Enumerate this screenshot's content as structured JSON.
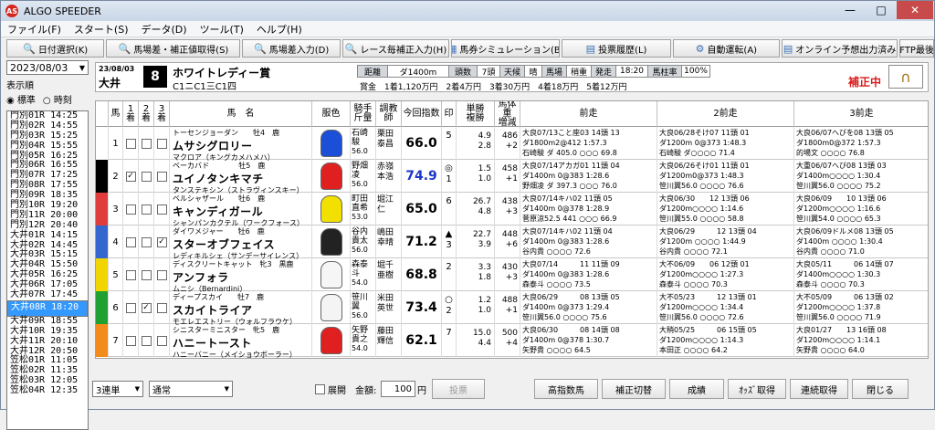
{
  "window": {
    "title": "ALGO SPEEDER",
    "app_icon": "AS",
    "minimize": "—",
    "maximize": "□",
    "close": "✕"
  },
  "menus": [
    "ファイル(F)",
    "スタート(S)",
    "データ(D)",
    "ツール(T)",
    "ヘルプ(H)"
  ],
  "toolbar": [
    {
      "icon": "search-icon",
      "label": "日付選択(K)"
    },
    {
      "icon": "search-icon",
      "label": "馬場差・補正値取得(S)"
    },
    {
      "icon": "search-icon",
      "label": "馬場差入力(D)"
    },
    {
      "icon": "search-icon",
      "label": "レース毎補正入力(H)"
    },
    {
      "icon": "grid-icon",
      "label": "馬券シミュレーション(B)"
    },
    {
      "icon": "document-icon",
      "label": "投票履歴(L)"
    },
    {
      "icon": "gear-icon",
      "label": "自動運転(A)"
    },
    {
      "icon": "document-icon",
      "label": "オンライン予想出力済み"
    },
    {
      "icon": "",
      "label": "FTP最後"
    }
  ],
  "left": {
    "date": "2023/08/03",
    "display_order_label": "表示順",
    "opt_standard": "標準",
    "opt_time": "時刻",
    "races": [
      "門別01R 14:25",
      "門別02R 14:55",
      "門別03R 15:25",
      "門別04R 15:55",
      "門別05R 16:25",
      "門別06R 16:55",
      "門別07R 17:25",
      "門別08R 17:55",
      "門別09R 18:35",
      "門別10R 19:20",
      "門別11R 20:00",
      "門別12R 20:40",
      "大井01R 14:15",
      "大井02R 14:45",
      "大井03R 15:15",
      "大井04R 15:50",
      "大井05R 16:25",
      "大井06R 17:05",
      "大井07R 17:45",
      "大井08R 18:20",
      "大井09R 18:55",
      "大井10R 19:35",
      "大井11R 20:10",
      "大井12R 20:50",
      "笠松01R 11:05",
      "笠松02R 11:35",
      "笠松03R 12:05",
      "笠松04R 12:35"
    ],
    "selected_index": 19
  },
  "race_header": {
    "date": "23/08/03",
    "venue": "大井",
    "race_number": "8",
    "name": "ホワイトレディー賞",
    "class": "C1ニC1三C1四",
    "distance_label": "距離",
    "distance": "ダ1400m",
    "runners_label": "頭数",
    "runners": "7頭",
    "weather_label": "天候",
    "weather": "晴",
    "track_label": "馬場",
    "track": "稍重",
    "post_label": "発走",
    "post_time": "18:20",
    "rate_label": "馬柱率",
    "rate": "100%",
    "prize": "賞金　1着1,120万円　2着4万円　3着30万円　4着18万円　5着12万円",
    "status": "補正中"
  },
  "columns": {
    "waku": "",
    "num": "馬",
    "c1": "1着",
    "c2": "2着",
    "c3": "3着",
    "name": "馬　名",
    "silk": "服色",
    "jockey": "騎手\n斤量",
    "trainer": "調教\n師",
    "index": "今回指数",
    "mark": "印",
    "odds": "単勝\n複勝",
    "weight": "馬体重\n増減",
    "p1": "前走",
    "p2": "2前走",
    "p3": "3前走"
  },
  "horses": [
    {
      "waku": "1",
      "waku_color": "#ffffff",
      "num": "1",
      "c1": false,
      "c2": false,
      "c3": false,
      "info": "トーセンジョーダン　　牡4　鹿",
      "name": "ムサシグロリー",
      "sire": "マクロア（キングカメハメハ）",
      "silk_color": "#1c4fd8",
      "jockey": "石崎\n駿",
      "weight": "56.0",
      "trainer": "栗田\n泰昌",
      "index": "66.0",
      "index_color": "#000000",
      "mark": "",
      "rank": "5",
      "odds": "4.9\n2.8",
      "body": "486\n+2",
      "p1a": "大良07/13こと座03 14頭 13",
      "p1b": "ダ1800m2@412 1:57.3",
      "p1c": "石崎駿 ダ 405.0 ○○○ 69.8",
      "p2a": "大良06/28そけ07 11頭 01",
      "p2b": "ダ1200m 0@373 1:48.3",
      "p2c": "石崎駿 ダ○○○○ 71.4",
      "p3a": "大良06/07へびを08 13頭 05",
      "p3b": "ダ1800m0@372 1:57.3",
      "p3c": "的場文 ○○○○ 76.8"
    },
    {
      "waku": "2",
      "waku_color": "#000000",
      "num": "2",
      "c1": true,
      "c2": false,
      "c3": false,
      "info": "ベーカバド　　　　牡5　鹿",
      "name": "ユイノタンキマチ",
      "sire": "タンステキシン（ストラヴィンスキー）",
      "silk_color": "#e02020",
      "jockey": "野畑\n凌",
      "weight": "56.0",
      "trainer": "赤嶺\n本浩",
      "index": "74.9",
      "index_color": "#1a37c8",
      "mark": "◎",
      "rank": "1",
      "odds": "1.5\n1.0",
      "body": "458\n+1",
      "p1a": "大良07/14アカガ01 11頭 04",
      "p1b": "ダ1400m 0@383 1:28.6",
      "p1c": "野畑凌 ダ 397.3 ○○○ 76.0",
      "p2a": "大良06/26そけ01 11頭 01",
      "p2b": "ダ1200m0@373 1:48.3",
      "p2c": "笹川翼56.0 ○○○○ 76.6",
      "p3a": "大重06/07へび08 13頭 03",
      "p3b": "ダ1400m○○○○ 1:30.4",
      "p3c": "笹川翼56.0 ○○○○ 75.2"
    },
    {
      "waku": "3",
      "waku_color": "#e03c3c",
      "num": "3",
      "c1": false,
      "c2": false,
      "c3": false,
      "info": "ベルシャザール　　牡6　鹿",
      "name": "キャンディガール",
      "sire": "シャンパンカクテル（ワークフォース）",
      "silk_color": "#f1e000",
      "jockey": "町田\n直希",
      "weight": "53.0",
      "trainer": "堀江\n仁",
      "index": "65.0",
      "index_color": "#000000",
      "mark": "",
      "rank": "6",
      "odds": "26.7\n4.8",
      "body": "438\n+3",
      "p1a": "大良07/14キハ02 11頭 05",
      "p1b": "ダ1400m 0@378 1:28.9",
      "p1c": "菅原涼52.5 441 ○○○ 66.9",
      "p2a": "大良06/30　　12 13頭 06",
      "p2b": "ダ1200m○○○○ 1:14.6",
      "p2c": "笹川翼55.0 ○○○○ 58.8",
      "p3a": "大良06/09　　10 13頭 06",
      "p3b": "ダ1200m○○○○ 1:16.6",
      "p3c": "笹川翼54.0 ○○○○ 65.3"
    },
    {
      "waku": "4",
      "waku_color": "#3466d0",
      "num": "4",
      "c1": false,
      "c2": false,
      "c3": true,
      "info": "ダイワメジャー　　牡6　鹿",
      "name": "スターオブフェイス",
      "sire": "レディキルシェ（サンデーサイレンス）",
      "silk_color": "#222222",
      "jockey": "谷内\n貴太",
      "weight": "56.0",
      "trainer": "嶋田\n幸晴",
      "index": "71.2",
      "index_color": "#000000",
      "mark": "▲",
      "rank": "3",
      "odds": "22.7\n3.9",
      "body": "448\n+6",
      "p1a": "大良07/14キハ02 11頭 04",
      "p1b": "ダ1400m 0@383 1:28.6",
      "p1c": "谷内貴 ○○○○ 72.6",
      "p2a": "大良06/29　　　12 13頭 04",
      "p2b": "ダ1200m ○○○○ 1:44.9",
      "p2c": "谷内貴 ○○○○ 72.1",
      "p3a": "大良06/09ドルメ08 13頭 05",
      "p3b": "ダ1400m ○○○○ 1:30.4",
      "p3c": "谷内貴 ○○○○ 71.0"
    },
    {
      "waku": "5",
      "waku_color": "#f2d500",
      "num": "5",
      "c1": false,
      "c2": false,
      "c3": false,
      "info": "ディスクリートキャット　牝3　黒鹿",
      "name": "アンフォラ",
      "sire": "ムニシ（Bernardini）",
      "silk_color": "#f6f6f6",
      "jockey": "森泰\n斗",
      "weight": "54.0",
      "trainer": "堀千\n亜樹",
      "index": "68.8",
      "index_color": "#000000",
      "mark": "",
      "rank": "2",
      "odds": "3.3\n1.8",
      "body": "430\n+3",
      "p1a": "大良07/14　　　11 11頭 09",
      "p1b": "ダ1400m 0@383 1:28.6",
      "p1c": "森泰斗 ○○○○ 73.5",
      "p2a": "大不06/09　　06 12頭 01",
      "p2b": "ダ1200m○○○○ 1:27.3",
      "p2c": "森泰斗 ○○○○ 70.3",
      "p3a": "大良05/11　　　06 14頭 07",
      "p3b": "ダ1400m○○○○ 1:30.3",
      "p3c": "森泰斗 ○○○○ 70.3"
    },
    {
      "waku": "6",
      "waku_color": "#20a030",
      "num": "6",
      "c1": false,
      "c2": true,
      "c3": false,
      "info": "ディープスカイ　　牡7　鹿",
      "name": "スカイトライア",
      "sire": "モエレエストリー（ウォルフラウケ）",
      "silk_color": "#f4f4f4",
      "jockey": "笹川\n翼",
      "weight": "56.0",
      "trainer": "米田\n英世",
      "index": "73.4",
      "index_color": "#000000",
      "mark": "○",
      "rank": "2",
      "odds": "1.2\n1.0",
      "body": "488\n+1",
      "p1a": "大良06/29　　　08 13頭 05",
      "p1b": "ダ1400m 0@373 1:29.4",
      "p1c": "笹川翼56.0 ○○○○ 75.6",
      "p2a": "大不05/23　　　12 13頭 01",
      "p2b": "ダ1200m○○○○ 1:34.4",
      "p2c": "笹川翼56.0 ○○○○ 72.6",
      "p3a": "大不05/09　　　06 13頭 02",
      "p3b": "ダ1200m○○○○ 1:37.8",
      "p3c": "笹川翼56.0 ○○○○ 71.9"
    },
    {
      "waku": "7",
      "waku_color": "#f28a1c",
      "num": "7",
      "c1": false,
      "c2": false,
      "c3": false,
      "info": "シニスターミニスター　牝5　鹿",
      "name": "ハニートースト",
      "sire": "ハニーバニー（メイショウボーラー）",
      "silk_color": "#e02020",
      "jockey": "矢野\n貴之",
      "weight": "54.0",
      "trainer": "藤田\n輝信",
      "index": "62.1",
      "index_color": "#000000",
      "mark": "",
      "rank": "7",
      "odds": "15.0\n4.4",
      "body": "500\n+4",
      "p1a": "大良06/30　　　08 14頭 08",
      "p1b": "ダ1400m 0@378 1:30.7",
      "p1c": "矢野貴 ○○○○ 64.5",
      "p2a": "大稍05/25　　　06 15頭 05",
      "p2b": "ダ1200m○○○○ 1:14.3",
      "p2c": "本田正 ○○○○ 64.2",
      "p3a": "大良01/27　　13 16頭 08",
      "p3b": "ダ1200m○○○○ 1:14.1",
      "p3c": "矢野貴 ○○○○ 64.0"
    }
  ],
  "bottom": {
    "bet_type": "3連単",
    "mode": "通常",
    "expand": "展開",
    "amount_label": "金額:",
    "amount": "100",
    "amount_unit": "円",
    "vote": "投票",
    "btn_odds": "高指数馬",
    "btn_switch": "補正切替",
    "btn_result": "成績",
    "btn_odds_get": "ｵｯｽﾞ取得",
    "btn_conn": "連続取得",
    "btn_close": "閉じる"
  }
}
